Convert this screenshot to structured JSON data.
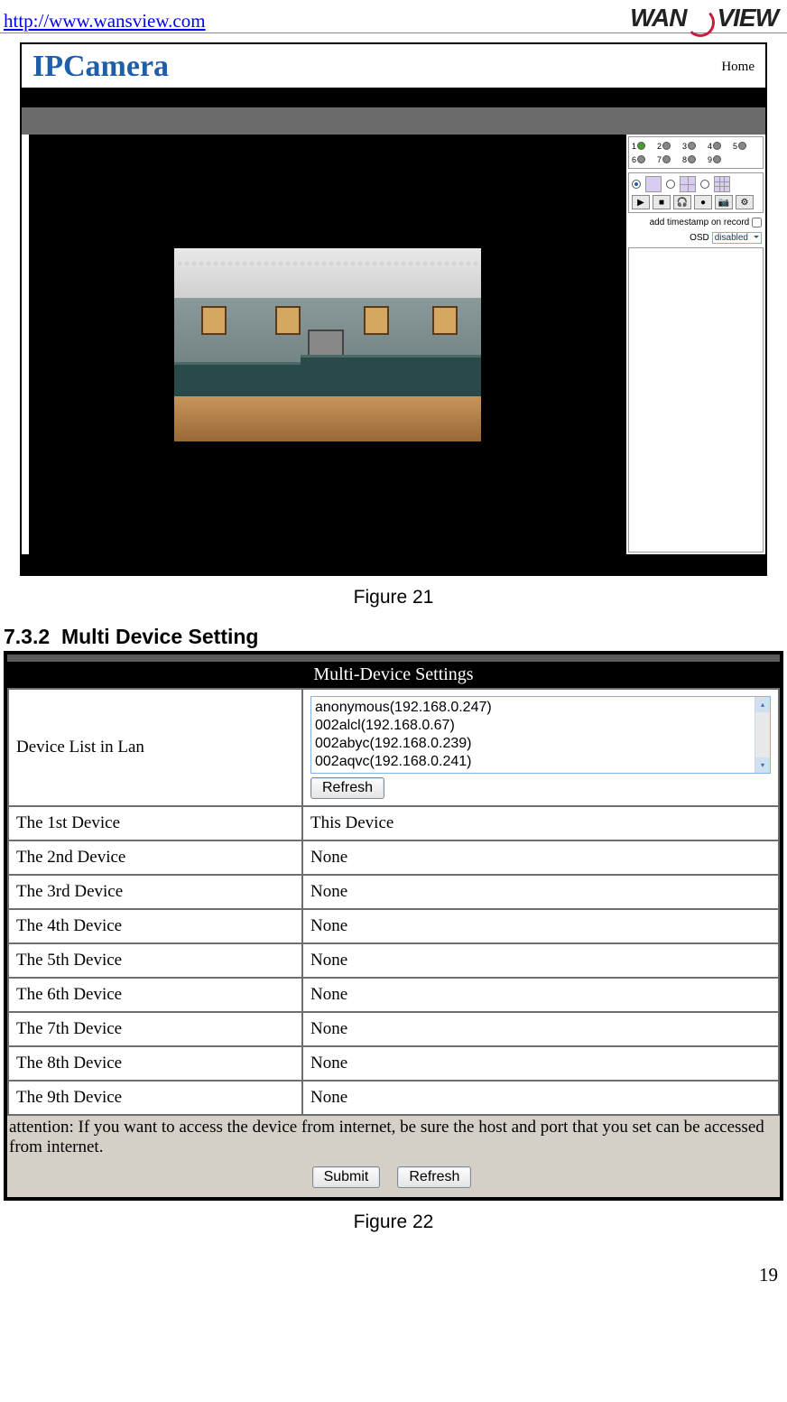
{
  "header": {
    "url": "http://www.wansview.com",
    "brand_prefix": "WAN",
    "brand_s": "S",
    "brand_suffix": "VIEW"
  },
  "fig1": {
    "title": "IPCamera",
    "home": "Home",
    "channels": [
      "1",
      "2",
      "3",
      "4",
      "5",
      "6",
      "7",
      "8",
      "9"
    ],
    "timestamp_label": "add timestamp on record",
    "osd_label": "OSD",
    "osd_value": "disabled",
    "caption": "Figure 21"
  },
  "section": {
    "number": "7.3.2",
    "title": "Multi Device Setting"
  },
  "fig2": {
    "title": "Multi-Device Settings",
    "devlist_label": "Device List in Lan",
    "devlist_items": [
      "anonymous(192.168.0.247)",
      "002alcl(192.168.0.67)",
      "002abyc(192.168.0.239)",
      "002aqvc(192.168.0.241)"
    ],
    "refresh": "Refresh",
    "rows": [
      {
        "label": "The 1st Device",
        "value": "This Device"
      },
      {
        "label": "The 2nd Device",
        "value": "None"
      },
      {
        "label": "The 3rd Device",
        "value": "None"
      },
      {
        "label": "The 4th Device",
        "value": "None"
      },
      {
        "label": "The 5th Device",
        "value": "None"
      },
      {
        "label": "The 6th Device",
        "value": "None"
      },
      {
        "label": "The 7th Device",
        "value": "None"
      },
      {
        "label": "The 8th Device",
        "value": "None"
      },
      {
        "label": "The 9th Device",
        "value": "None"
      }
    ],
    "attention": "attention: If you want to access the device from internet, be sure the host and port that you set can be accessed from internet.",
    "submit": "Submit",
    "caption": "Figure 22"
  },
  "page_number": "19"
}
